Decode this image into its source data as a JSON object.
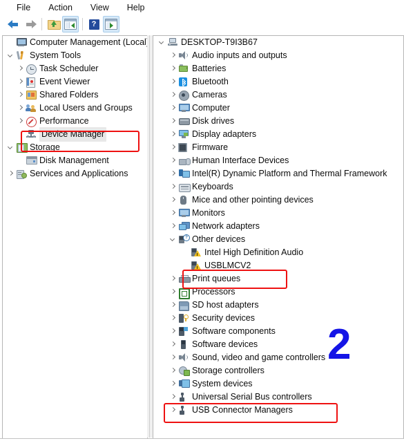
{
  "window": {
    "app_title": "Computer Management",
    "menu": [
      {
        "label": "File"
      },
      {
        "label": "Action"
      },
      {
        "label": "View"
      },
      {
        "label": "Help"
      }
    ],
    "toolbar": [
      {
        "name": "back-arrow-icon",
        "label": "Back"
      },
      {
        "name": "forward-arrow-icon",
        "label": "Forward"
      },
      {
        "name": "up-one-level-icon",
        "label": "Up one level"
      },
      {
        "name": "show-hide-console-tree-icon",
        "label": "Show/Hide Console Tree"
      },
      {
        "name": "help-icon",
        "label": "Help"
      },
      {
        "name": "show-hide-action-pane-icon",
        "label": "Show/Hide Action Pane"
      }
    ]
  },
  "console_tree": {
    "items": [
      {
        "label": "Computer Management (Local)",
        "icon": "computer-management-icon",
        "indent": 0,
        "chevron": "none",
        "selected": false
      },
      {
        "label": "System Tools",
        "icon": "system-tools-icon",
        "indent": 1,
        "chevron": "open",
        "selected": false
      },
      {
        "label": "Task Scheduler",
        "icon": "task-scheduler-icon",
        "indent": 2,
        "chevron": "closed",
        "selected": false
      },
      {
        "label": "Event Viewer",
        "icon": "event-viewer-icon",
        "indent": 2,
        "chevron": "closed",
        "selected": false
      },
      {
        "label": "Shared Folders",
        "icon": "shared-folders-icon",
        "indent": 2,
        "chevron": "closed",
        "selected": false
      },
      {
        "label": "Local Users and Groups",
        "icon": "local-users-and-groups-icon",
        "indent": 2,
        "chevron": "closed",
        "selected": false
      },
      {
        "label": "Performance",
        "icon": "performance-icon",
        "indent": 2,
        "chevron": "closed",
        "selected": false
      },
      {
        "label": "Device Manager",
        "icon": "device-manager-icon",
        "indent": 2,
        "chevron": "none",
        "selected": true
      },
      {
        "label": "Storage",
        "icon": "storage-icon",
        "indent": 1,
        "chevron": "open",
        "selected": false
      },
      {
        "label": "Disk Management",
        "icon": "disk-management-icon",
        "indent": 2,
        "chevron": "none",
        "selected": false
      },
      {
        "label": "Services and Applications",
        "icon": "services-and-applications-icon",
        "indent": 1,
        "chevron": "closed",
        "selected": false
      }
    ]
  },
  "device_tree": {
    "items": [
      {
        "label": "DESKTOP-T9I3B67",
        "icon": "computer-node-icon",
        "indent": 0,
        "chevron": "open"
      },
      {
        "label": "Audio inputs and outputs",
        "icon": "speaker-icon",
        "indent": 1,
        "chevron": "closed"
      },
      {
        "label": "Batteries",
        "icon": "battery-icon",
        "indent": 1,
        "chevron": "closed"
      },
      {
        "label": "Bluetooth",
        "icon": "bluetooth-icon",
        "indent": 1,
        "chevron": "closed"
      },
      {
        "label": "Cameras",
        "icon": "camera-icon",
        "indent": 1,
        "chevron": "closed"
      },
      {
        "label": "Computer",
        "icon": "monitor-icon",
        "indent": 1,
        "chevron": "closed"
      },
      {
        "label": "Disk drives",
        "icon": "disk-drive-icon",
        "indent": 1,
        "chevron": "closed"
      },
      {
        "label": "Display adapters",
        "icon": "display-adapter-icon",
        "indent": 1,
        "chevron": "closed"
      },
      {
        "label": "Firmware",
        "icon": "firmware-icon",
        "indent": 1,
        "chevron": "closed"
      },
      {
        "label": "Human Interface Devices",
        "icon": "human-interface-device-icon",
        "indent": 1,
        "chevron": "closed"
      },
      {
        "label": "Intel(R) Dynamic Platform and Thermal Framework",
        "icon": "intel-dptf-icon",
        "indent": 1,
        "chevron": "closed"
      },
      {
        "label": "Keyboards",
        "icon": "keyboard-icon",
        "indent": 1,
        "chevron": "closed"
      },
      {
        "label": "Mice and other pointing devices",
        "icon": "mouse-icon",
        "indent": 1,
        "chevron": "closed"
      },
      {
        "label": "Monitors",
        "icon": "monitor-icon",
        "indent": 1,
        "chevron": "closed"
      },
      {
        "label": "Network adapters",
        "icon": "network-adapter-icon",
        "indent": 1,
        "chevron": "closed"
      },
      {
        "label": "Other devices",
        "icon": "other-devices-icon",
        "indent": 1,
        "chevron": "open"
      },
      {
        "label": "Intel High Definition Audio",
        "icon": "unknown-device-warning-icon",
        "indent": 2,
        "chevron": "none"
      },
      {
        "label": "USBLMCV2",
        "icon": "unknown-device-warning-icon",
        "indent": 2,
        "chevron": "none"
      },
      {
        "label": "Print queues",
        "icon": "print-queue-icon",
        "indent": 1,
        "chevron": "closed"
      },
      {
        "label": "Processors",
        "icon": "processor-icon",
        "indent": 1,
        "chevron": "closed"
      },
      {
        "label": "SD host adapters",
        "icon": "sd-host-adapter-icon",
        "indent": 1,
        "chevron": "closed"
      },
      {
        "label": "Security devices",
        "icon": "security-device-icon",
        "indent": 1,
        "chevron": "closed"
      },
      {
        "label": "Software components",
        "icon": "software-component-icon",
        "indent": 1,
        "chevron": "closed"
      },
      {
        "label": "Software devices",
        "icon": "software-device-icon",
        "indent": 1,
        "chevron": "closed"
      },
      {
        "label": "Sound, video and game controllers",
        "icon": "speaker-icon",
        "indent": 1,
        "chevron": "closed"
      },
      {
        "label": "Storage controllers",
        "icon": "storage-controller-icon",
        "indent": 1,
        "chevron": "closed"
      },
      {
        "label": "System devices",
        "icon": "system-device-icon",
        "indent": 1,
        "chevron": "closed"
      },
      {
        "label": "Universal Serial Bus controllers",
        "icon": "usb-icon",
        "indent": 1,
        "chevron": "closed"
      },
      {
        "label": "USB Connector Managers",
        "icon": "usb-icon",
        "indent": 1,
        "chevron": "closed"
      }
    ]
  },
  "annotations": {
    "step_number": "2",
    "step_number_color": "#1414e6",
    "highlight_color": "#ee1111",
    "highlight_targets": [
      "Device Manager",
      "USBLMCV2",
      "Universal Serial Bus controllers"
    ]
  }
}
